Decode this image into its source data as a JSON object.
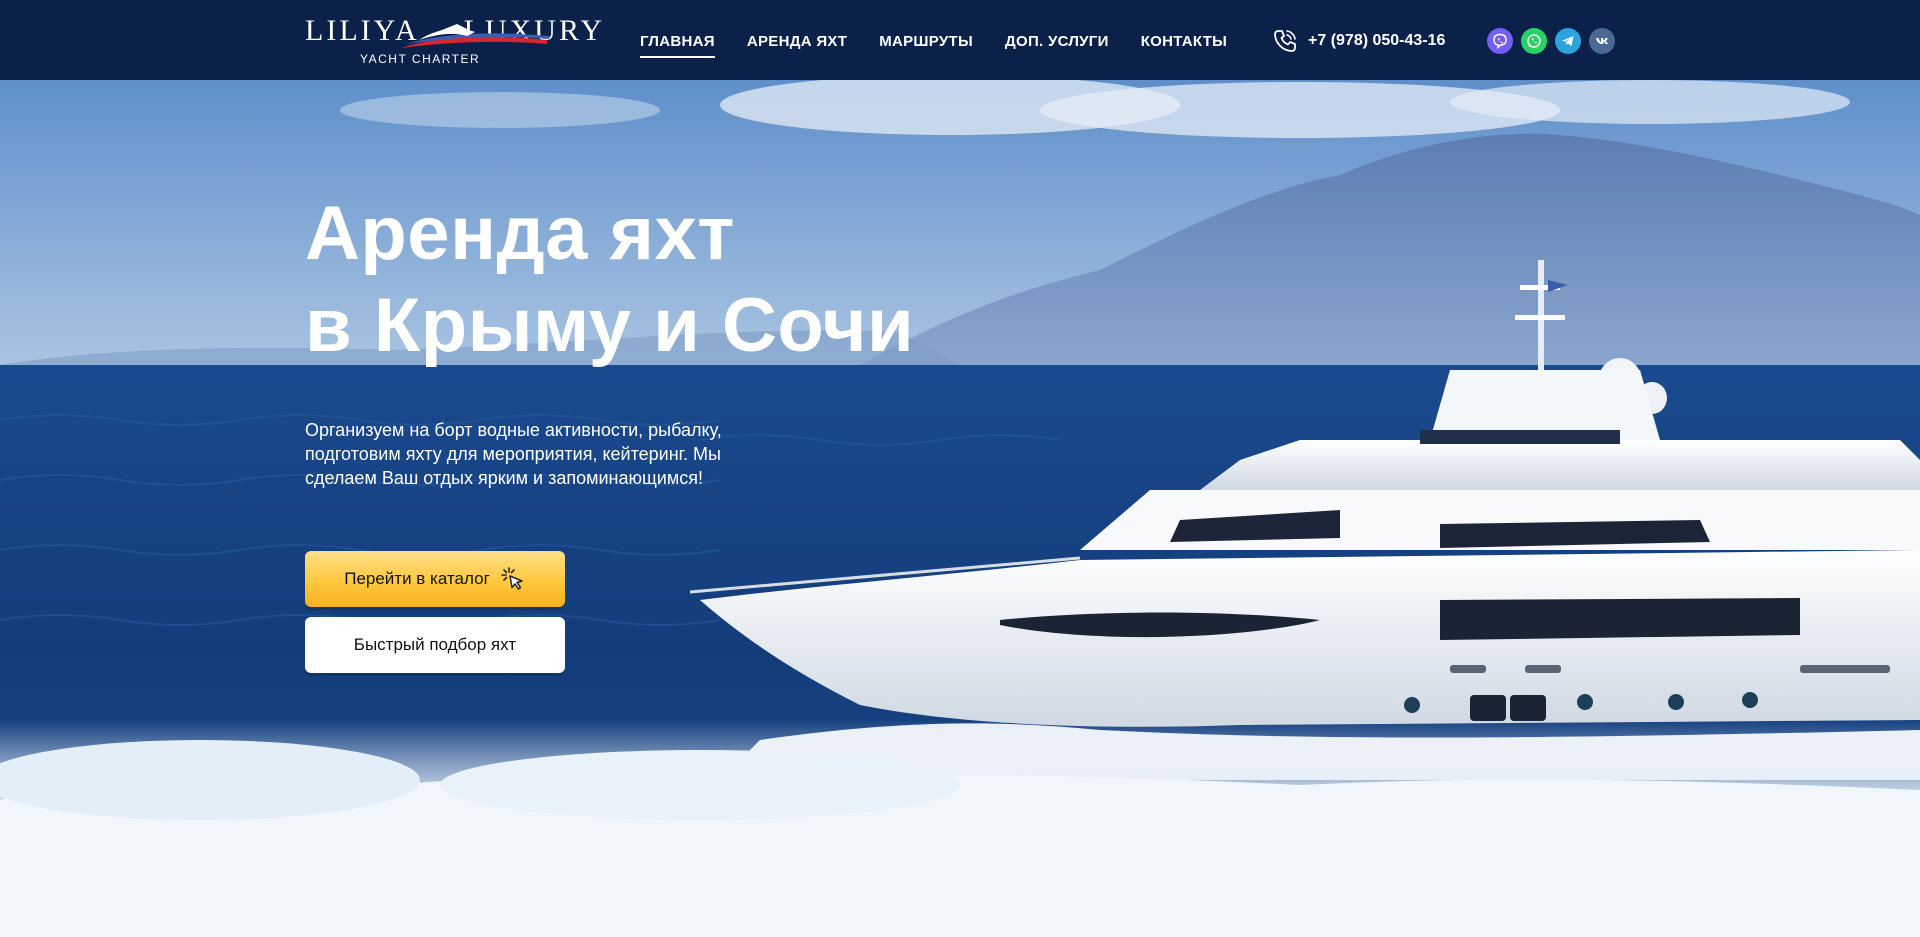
{
  "header": {
    "logo": {
      "name_left": "LILIYA",
      "name_right": "LUXURY",
      "subtitle": "YACHT CHARTER"
    },
    "nav": [
      {
        "label": "ГЛАВНАЯ",
        "active": true
      },
      {
        "label": "АРЕНДА ЯХТ",
        "active": false
      },
      {
        "label": "МАРШРУТЫ",
        "active": false
      },
      {
        "label": "ДОП. УСЛУГИ",
        "active": false
      },
      {
        "label": "КОНТАКТЫ",
        "active": false
      }
    ],
    "phone": {
      "number": "+7 (978) 050-43-16",
      "icon": "phone-icon"
    },
    "socials": [
      {
        "icon": "viber-icon",
        "color": "#7360f2"
      },
      {
        "icon": "whatsapp-icon",
        "color": "#25d366"
      },
      {
        "icon": "telegram-icon",
        "color": "#2aa3df"
      },
      {
        "icon": "vk-icon",
        "color": "#4a6a94"
      }
    ]
  },
  "hero": {
    "title_line1": "Аренда яхт",
    "title_line2": "в Крыму и Сочи",
    "description": "Организуем на борт водные активности, рыбалку, подготовим яхту для мероприятия, кейтеринг. Мы сделаем Ваш отдых ярким и запоминающимся!",
    "buttons": {
      "catalog": "Перейти в каталог",
      "quick_pick": "Быстрый подбор яхт"
    }
  },
  "colors": {
    "header_bg": "#0b2149",
    "accent_yellow": "#ffc83d",
    "text_light": "#ffffff"
  }
}
